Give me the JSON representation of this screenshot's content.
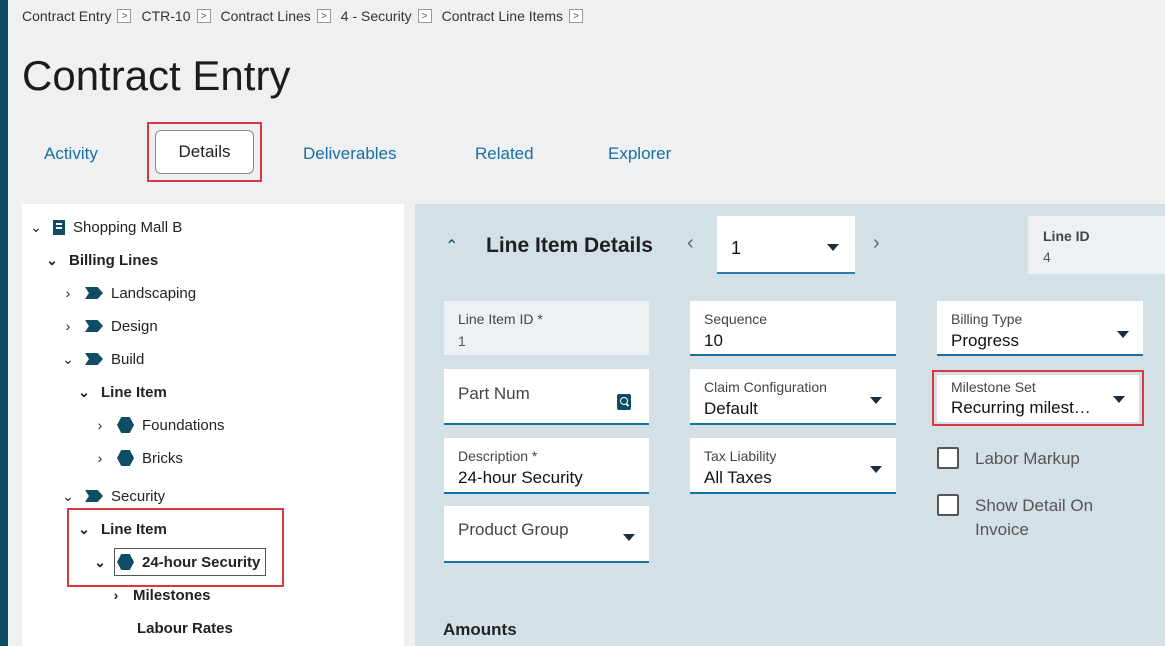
{
  "breadcrumb": [
    {
      "label": "Contract Entry"
    },
    {
      "label": "CTR-10"
    },
    {
      "label": "Contract Lines"
    },
    {
      "label": "4 - Security"
    },
    {
      "label": "Contract Line Items"
    }
  ],
  "breadcrumb_sep": ">",
  "page_title": "Contract Entry",
  "tabs": {
    "activity": "Activity",
    "details": "Details",
    "deliverables": "Deliverables",
    "related": "Related",
    "explorer": "Explorer"
  },
  "tree": {
    "root": "Shopping Mall B",
    "billing_lines": "Billing Lines",
    "landscaping": "Landscaping",
    "design": "Design",
    "build": "Build",
    "build_line_item": "Line Item",
    "foundations": "Foundations",
    "bricks": "Bricks",
    "security": "Security",
    "security_line_item": "Line Item",
    "security_24h": "24-hour Security",
    "milestones": "Milestones",
    "labour_rates": "Labour Rates"
  },
  "detail": {
    "title": "Line Item Details",
    "selected_item": "1",
    "line_id_label": "Line ID",
    "line_id_value": "4"
  },
  "fields": {
    "line_item_id_label": "Line Item ID *",
    "line_item_id_value": "1",
    "sequence_label": "Sequence",
    "sequence_value": "10",
    "billing_type_label": "Billing Type",
    "billing_type_value": "Progress",
    "part_num_placeholder": "Part Num",
    "claim_config_label": "Claim Configuration",
    "claim_config_value": "Default",
    "milestone_set_label": "Milestone Set",
    "milestone_set_value": "Recurring milest…",
    "description_label": "Description *",
    "description_value": "24-hour Security",
    "tax_liability_label": "Tax Liability",
    "tax_liability_value": "All Taxes",
    "labor_markup_label": "Labor Markup",
    "show_detail_label_1": "Show Detail On",
    "show_detail_label_2": "Invoice",
    "product_group_placeholder": "Product Group"
  },
  "sections": {
    "amounts": "Amounts"
  },
  "colors": {
    "accent": "#1a6fa3",
    "brand_dark": "#0e4d63",
    "highlight_red": "#d9393e",
    "panel_bg": "#d3e0e6"
  }
}
